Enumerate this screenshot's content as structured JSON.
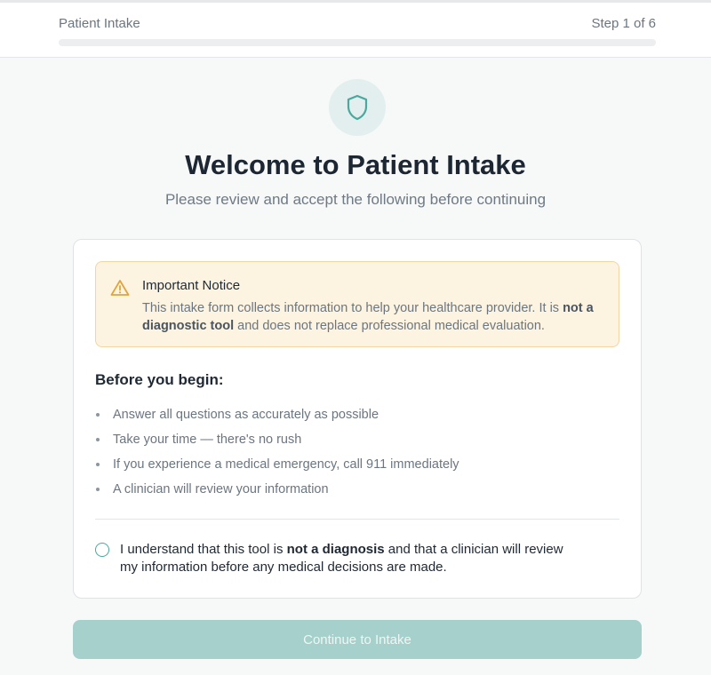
{
  "header": {
    "title": "Patient Intake",
    "step_label": "Step 1 of 6",
    "progress_fraction": 0
  },
  "hero": {
    "icon": "shield-icon",
    "title": "Welcome to Patient Intake",
    "subtitle": "Please review and accept the following before continuing"
  },
  "notice": {
    "icon": "warning-icon",
    "title": "Important Notice",
    "body_before": "This intake form collects information to help your healthcare provider. It is ",
    "body_bold": "not a diagnostic tool",
    "body_after": " and does not replace professional medical evaluation."
  },
  "before_begin": {
    "title": "Before you begin:",
    "items": [
      "Answer all questions as accurately as possible",
      "Take your time — there's no rush",
      "If you experience a medical emergency, call 911 immediately",
      "A clinician will review your information"
    ]
  },
  "consent": {
    "checked": false,
    "text_before": "I understand that this tool is ",
    "text_bold": "not a diagnosis",
    "text_after": " and that a clinician will review my information before any medical decisions are made."
  },
  "continue_button": {
    "label": "Continue to Intake",
    "disabled": true
  },
  "colors": {
    "accent": "#4aa89e",
    "button_disabled": "#a5d0cb",
    "notice_bg": "#fdf3e1",
    "notice_border": "#f1d5a3",
    "warning": "#e0a43a"
  }
}
